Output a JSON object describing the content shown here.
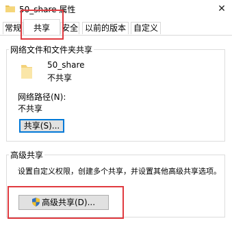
{
  "window": {
    "title": "50_share 属性",
    "close_glyph": "✕"
  },
  "tabs": [
    {
      "label": "常规",
      "active": false
    },
    {
      "label": "共享",
      "active": true
    },
    {
      "label": "安全",
      "active": false
    },
    {
      "label": "以前的版本",
      "active": false
    },
    {
      "label": "自定义",
      "active": false
    }
  ],
  "network_sharing": {
    "group_title": "网络文件和文件夹共享",
    "folder_name": "50_share",
    "folder_status": "不共享",
    "path_label": "网络路径(N):",
    "path_value": "不共享",
    "share_button": "共享(S)..."
  },
  "advanced_sharing": {
    "group_title": "高级共享",
    "description": "设置自定义权限，创建多个共享，并设置其他高级共享选项。",
    "button": "高级共享(D)..."
  },
  "icons": {
    "folder": "folder-icon",
    "shield": "uac-shield-icon",
    "title": "folder-small-icon"
  },
  "colors": {
    "highlight": "#e0393e",
    "focus": "#0078d7",
    "button_bg": "#e1e1e1"
  }
}
